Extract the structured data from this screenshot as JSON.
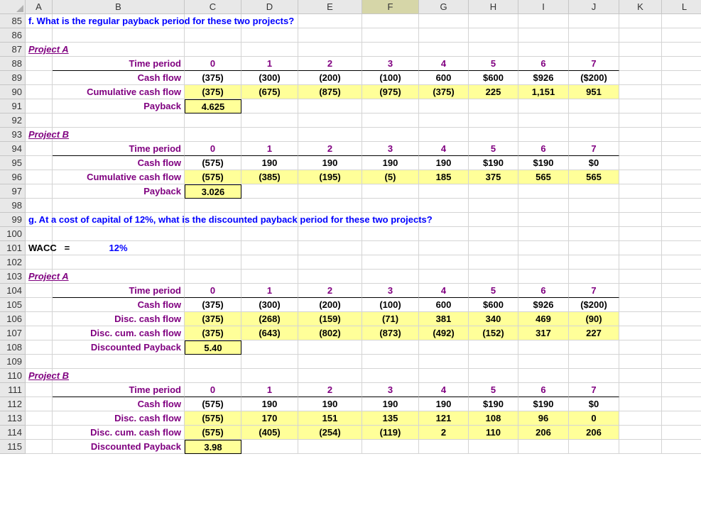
{
  "columns": [
    "A",
    "B",
    "C",
    "D",
    "E",
    "F",
    "G",
    "H",
    "I",
    "J",
    "K",
    "L"
  ],
  "selected_col": "F",
  "rows": [
    "85",
    "86",
    "87",
    "88",
    "89",
    "90",
    "91",
    "92",
    "93",
    "94",
    "95",
    "96",
    "97",
    "98",
    "99",
    "100",
    "101",
    "102",
    "103",
    "104",
    "105",
    "106",
    "107",
    "108",
    "109",
    "110",
    "111",
    "112",
    "113",
    "114",
    "115"
  ],
  "q_f": "f.   What is the regular payback period for these two projects?",
  "q_g": "g.    At a cost of capital of 12%, what is the discounted payback period for these two projects?",
  "labels": {
    "projA": "Project A",
    "projB": "Project B",
    "time": "Time period",
    "cf": "Cash flow",
    "ccf": "Cumulative cash flow",
    "payback": "Payback",
    "dcf": "Disc. cash flow",
    "dccf": "Disc. cum. cash flow",
    "dpayback": "Discounted Payback",
    "wacc_a": "WACC",
    "wacc_eq": "=",
    "wacc_val": "12%"
  },
  "periods": [
    "0",
    "1",
    "2",
    "3",
    "4",
    "5",
    "6",
    "7"
  ],
  "A": {
    "cf": [
      "(375)",
      "(300)",
      "(200)",
      "(100)",
      "600",
      "$600",
      "$926",
      "($200)"
    ],
    "ccf": [
      "(375)",
      "(675)",
      "(875)",
      "(975)",
      "(375)",
      "225",
      "1,151",
      "951"
    ],
    "pb": "4.625",
    "dcf": [
      "(375)",
      "(268)",
      "(159)",
      "(71)",
      "381",
      "340",
      "469",
      "(90)"
    ],
    "dccf": [
      "(375)",
      "(643)",
      "(802)",
      "(873)",
      "(492)",
      "(152)",
      "317",
      "227"
    ],
    "dpb": "5.40"
  },
  "B": {
    "cf": [
      "(575)",
      "190",
      "190",
      "190",
      "190",
      "$190",
      "$190",
      "$0"
    ],
    "ccf": [
      "(575)",
      "(385)",
      "(195)",
      "(5)",
      "185",
      "375",
      "565",
      "565"
    ],
    "pb": "3.026",
    "dcf": [
      "(575)",
      "170",
      "151",
      "135",
      "121",
      "108",
      "96",
      "0"
    ],
    "dccf": [
      "(575)",
      "(405)",
      "(254)",
      "(119)",
      "2",
      "110",
      "206",
      "206"
    ],
    "dpb": "3.98"
  }
}
